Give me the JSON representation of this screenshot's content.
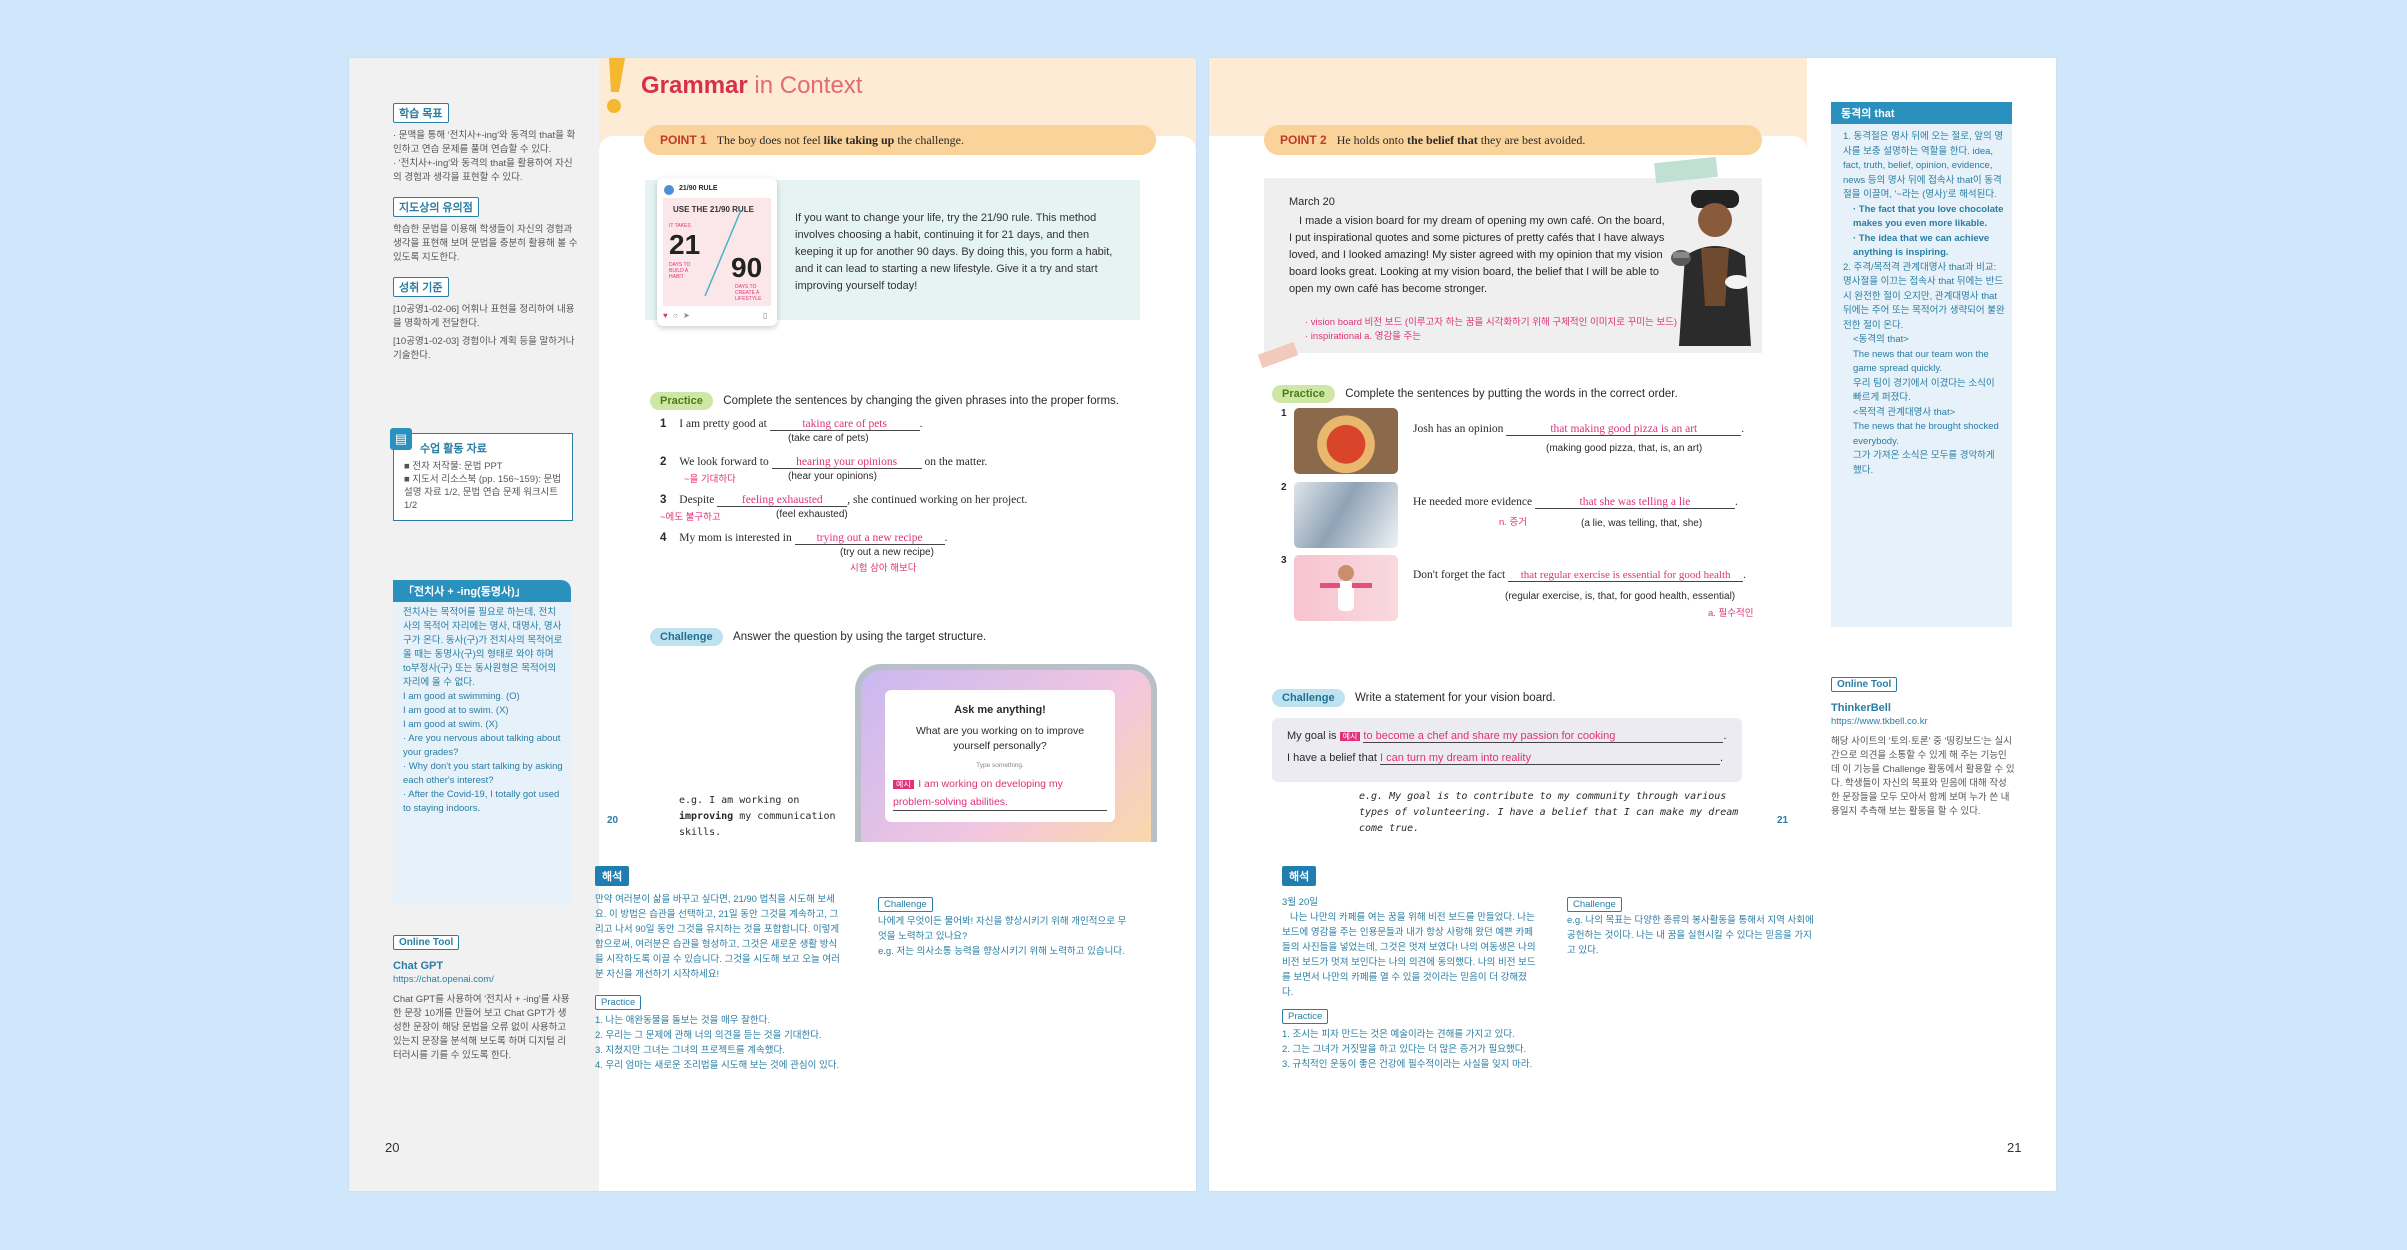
{
  "left_page": {
    "sidebar": {
      "objectives_title": "학습 목표",
      "objectives": [
        "· 문맥을 통해 '전치사+-ing'와 동격의 that을 확인하고 연습 문제를 풀며 연습할 수 있다.",
        "· '전치사+-ing'와 동격의 that을 활용하여 자신의 경험과 생각을 표현할 수 있다."
      ],
      "notes_title": "지도상의 유의점",
      "notes": "학습한 문법을 이용해 학생들이 자신의 경험과 생각을 표현해 보며 문법을 충분히 활용해 볼 수 있도록 지도한다.",
      "standards_title": "성취 기준",
      "standards": [
        "[10공영1-02-06] 어휘나 표현을 정리하여 내용을 명확하게 전달한다.",
        "[10공영1-02-03] 경험이나 계획 등을 말하거나 기술한다."
      ],
      "materials_title": "수업 활동 자료",
      "materials": [
        "■ 전자 저작물: 문법 PPT",
        "■ 지도서 리소스북 (pp. 156~159): 문법 설명 자료 1/2, 문법 연습 문제 워크시트 1/2"
      ],
      "gerund_title": "「전치사 + -ing(동명사)」",
      "gerund_text": "전치사는 목적어를 필요로 하는데, 전치사의 목적어 자리에는 명사, 대명사, 명사구가 온다. 동사(구)가 전치사의 목적어로 올 때는 동명사(구)의 형태로 와야 하며 to부정사(구) 또는 동사원형은 목적어의 자리에 올 수 없다.",
      "gerund_examples": [
        "I am good at swimming. (O)",
        "I am good at to swim. (X)",
        "I am good at swim. (X)",
        "· Are you nervous about talking about your grades?",
        "· Why don't you start talking by asking each other's interest?",
        "· After the Covid-19, I totally got used to staying indoors."
      ],
      "online_tool_label": "Online Tool",
      "tool_name": "Chat GPT",
      "tool_url": "https://chat.openai.com/",
      "tool_desc": "Chat GPT를 사용하여 '전치사 + -ing'를 사용한 문장 10개를 만들어 보고 Chat GPT가 생성한 문장이 해당 문법을 오류 없이 사용하고 있는지 문장을 분석해 보도록 하며 디지털 리터러시를 기를 수 있도록 한다."
    },
    "header_title_1": "Grammar",
    "header_title_2": " in Context",
    "point_label": "POINT 1",
    "point_text_1": "The boy does not feel ",
    "point_text_bold": "like taking up",
    "point_text_2": " the challenge.",
    "card": {
      "handle": "21/90 RULE",
      "heading": "USE THE 21/90 RULE",
      "left_top": "IT TAKES",
      "left_num": "21",
      "left_bottom": "DAYS TO BUILD A HABIT",
      "right_num": "90",
      "right_bottom": "DAYS TO CREATE A LIFESTYLE"
    },
    "passage": "If you want to change your life, try the 21/90 rule. This method involves choosing a habit, continuing it for 21 days, and then keeping it up for another 90 days. By doing this, you form a habit, and it can lead to starting a new lifestyle. Give it a try and start improving yourself today!",
    "practice_label": "Practice",
    "practice_instruction": "Complete the sentences by changing the given phrases into the proper forms.",
    "practice_items": [
      {
        "num": "1",
        "before": "I am pretty good at",
        "answer": "taking care of pets",
        "after": ".",
        "hint": "(take care of pets)",
        "note": ""
      },
      {
        "num": "2",
        "before": "We look forward to",
        "answer": "hearing your opinions",
        "after": "on the matter.",
        "hint": "(hear your opinions)",
        "note": "~을 기대하다"
      },
      {
        "num": "3",
        "before": "Despite",
        "answer": "feeling exhausted",
        "after": ", she continued working on her project.",
        "hint": "(feel exhausted)",
        "note": "~에도 불구하고"
      },
      {
        "num": "4",
        "before": "My mom is interested in",
        "answer": "trying out a new recipe",
        "after": ".",
        "hint": "(try out a new recipe)",
        "note": "시험 삼아 해보다"
      }
    ],
    "challenge_label": "Challenge",
    "challenge_instruction": "Answer the question by using the target structure.",
    "phone_title": "Ask me anything!",
    "phone_question": "What are you working on to improve yourself personally?",
    "phone_hint": "Type something.",
    "phone_tag": "예시",
    "phone_answer": "I am working on developing my problem-solving abilities.",
    "eg_label": "e.g.",
    "eg_text_1": "I am working on ",
    "eg_text_bold": "improving",
    "eg_text_2": " my communication skills.",
    "inner_page_num": "20",
    "haeseok_label": "해석",
    "translation": "만약 여러분이 삶을 바꾸고 싶다면, 21/90 법칙을 시도해 보세요. 이 방법은 습관을 선택하고, 21일 동안 그것을 계속하고, 그리고 나서 90일 동안 그것을 유지하는 것을 포함합니다. 이렇게 함으로써, 여러분은 습관을 형성하고, 그것은 새로운 생활 방식을 시작하도록 이끌 수 있습니다. 그것을 시도해 보고 오늘 여러분 자신을 개선하기 시작하세요!",
    "trans_practice_label": "Practice",
    "trans_practice": [
      "1. 나는 애완동물을 돌보는 것을 매우 잘한다.",
      "2. 우리는 그 문제에 관해 너의 의견을 듣는 것을 기대한다.",
      "3. 지쳤지만 그녀는 그녀의 프로젝트를 계속했다.",
      "4. 우리 엄마는 새로운 조리법을 시도해 보는 것에 관심이 있다."
    ],
    "trans_challenge_label": "Challenge",
    "trans_challenge": "나에게 무엇이든 물어봐! 자신을 향상시키기 위해 개인적으로 무엇을 노력하고 있나요?",
    "trans_challenge_eg": "e.g. 저는 의사소통 능력을 향상시키기 위해 노력하고 있습니다.",
    "page_num": "20"
  },
  "right_page": {
    "point_label": "POINT 2",
    "point_text_1": "He holds onto ",
    "point_text_bold": "the belief that",
    "point_text_2": " they are best avoided.",
    "diary_date": "March 20",
    "diary_text": "I made a vision board for my dream of opening my own café. On the board, I put inspirational quotes and some pictures of pretty cafés that I have always loved, and I looked amazing! My sister agreed with my opinion that my vision board looks great. Looking at my vision board, the belief that I will be able to open my own café has become stronger.",
    "vocab": [
      "· vision board  비전 보드 (이루고자 하는 꿈을 시각화하기 위해 구체적인 이미지로 꾸미는 보드)",
      "· inspirational  a. 영감을 주는"
    ],
    "practice_label": "Practice",
    "practice_instruction": "Complete the sentences by putting the words in the correct order.",
    "practice_items": [
      {
        "num": "1",
        "before": "Josh has an opinion",
        "answer": "that making good pizza is an art",
        "hint": "(making good pizza, that, is, an art)",
        "note": ""
      },
      {
        "num": "2",
        "before": "He needed more evidence",
        "answer": "that she was telling a lie",
        "hint": "(a lie, was telling, that, she)",
        "note": "n. 증거"
      },
      {
        "num": "3",
        "before": "Don't forget the fact",
        "answer": "that regular exercise is essential for good health",
        "hint": "(regular exercise, is, that, for good health, essential)",
        "note": "a. 필수적인"
      }
    ],
    "challenge_label": "Challenge",
    "challenge_instruction": "Write a statement for your vision board.",
    "goal_prefix": "My goal is",
    "goal_tag": "예시",
    "goal_answer": "to become a chef and share my passion for cooking",
    "belief_prefix": "I have a belief that",
    "belief_answer": "I can turn my dream into reality",
    "eg_label": "e.g.",
    "eg_text": "My goal is to contribute to my community through various types of volunteering. I have a belief that I can make my dream come true.",
    "inner_page_num": "21",
    "haeseok_label": "해석",
    "translation_date": "3월 20일",
    "translation": "나는 나만의 카페를 여는 꿈을 위해 비전 보드를 만들었다. 나는 보드에 영감을 주는 인용문들과 내가 항상 사랑해 왔던 예쁜 카페들의 사진들을 넣었는데, 그것은 멋져 보였다! 나의 여동생은 나의 비전 보드가 멋져 보인다는 나의 의견에 동의했다. 나의 비전 보드를 보면서 나만의 카페를 열 수 있을 것이라는 믿음이 더 강해졌다.",
    "trans_practice_label": "Practice",
    "trans_practice": [
      "1. 조시는 피자 만드는 것은 예술이라는 견해를 가지고 있다.",
      "2. 그는 그녀가 거짓말을 하고 있다는 더 많은 증거가 필요했다.",
      "3. 규칙적인 운동이 좋은 건강에 필수적이라는 사실을 잊지 마라."
    ],
    "trans_challenge_label": "Challenge",
    "trans_challenge": "e.g. 나의 목표는 다양한 종류의 봉사활동을 통해서 지역 사회에 공헌하는 것이다. 나는 내 꿈을 실현시킬 수 있다는 믿음을 가지고 있다.",
    "sidebar": {
      "appositive_title": "동격의 that",
      "appositive_text": [
        "1. 동격절은 명사 뒤에 오는 절로, 앞의 명사를 보충 설명하는 역할을 한다. idea, fact, truth, belief, opinion, evidence, news 등의 명사 뒤에 접속사 that이 동격절을 이끌며, '~라는 (명사)'로 해석된다.",
        "· The fact that you love chocolate makes you even more likable.",
        "· The idea that we can achieve anything is inspiring.",
        "2. 주격/목적격 관계대명사 that과 비교: 명사절을 이끄는 접속사 that 뒤에는 반드시 완전한 절이 오지만, 관계대명사 that 뒤에는 주어 또는 목적어가 생략되어 불완전한 절이 온다.",
        "<동격의 that>",
        "The news that our team won the game spread quickly.",
        "우리 팀이 경기에서 이겼다는 소식이 빠르게 퍼졌다.",
        "<목적격 관계대명사 that>",
        "The news that he brought shocked everybody.",
        "그가 가져온 소식은 모두를 경악하게 했다."
      ],
      "online_tool_label": "Online Tool",
      "tool_name": "ThinkerBell",
      "tool_url": "https://www.tkbell.co.kr",
      "tool_desc": "해당 사이트의 '토의·토론' 중 '띵킹보드'는 실시간으로 의견을 소통할 수 있게 해 주는 기능인데 이 기능을 Challenge 활동에서 활용할 수 있다. 학생들이 자신의 목표와 믿음에 대해 작성한 문장들을 모두 모아서 함께 보며 누가 쓴 내용일지 추측해 보는 활동을 할 수 있다."
    },
    "page_num": "21"
  },
  "colors": {
    "background": "#cfe6fb",
    "accent_pink": "#e0317a",
    "accent_blue": "#2a7ea3",
    "point_pill": "#fad39a",
    "header_peach": "#fdebd6"
  }
}
